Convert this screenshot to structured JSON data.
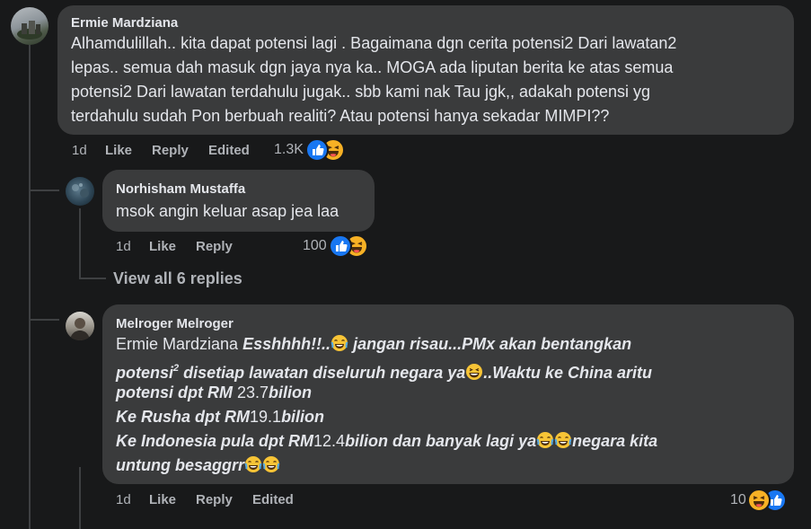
{
  "comments": [
    {
      "author": "Ermie Mardziana",
      "lines": [
        "Alhamdulillah.. kita dapat potensi lagi . Bagaimana dgn cerita potensi2 Dari lawatan2",
        "lepas.. semua dah masuk dgn jaya nya ka.. MOGA ada liputan berita ke atas semua",
        "potensi2 Dari lawatan terdahulu jugak.. sbb kami nak Tau jgk,, adakah potensi yg",
        "terdahulu sudah Pon berbuah realiti? Atau potensi hanya sekadar MIMPI??"
      ],
      "time": "1d",
      "like": "Like",
      "reply": "Reply",
      "edited": "Edited",
      "reaction_count": "1.3K"
    },
    {
      "author": "Norhisham Mustaffa",
      "text": "msok angin keluar asap jea laa",
      "time": "1d",
      "like": "Like",
      "reply": "Reply",
      "reaction_count": "100"
    },
    {
      "author": "Melroger Melroger",
      "mention": "Ermie Mardziana",
      "l1": [
        "Esshhhh!!..",
        "jangan risau...PMx akan bentangkan"
      ],
      "l2": [
        "potensi",
        "2",
        " disetiap lawatan diseluruh negara ya",
        "..Waktu ke China aritu"
      ],
      "l3": [
        "potensi dpt RM ",
        "23.7",
        "bilion"
      ],
      "l4": [
        "Ke Rusha dpt RM",
        "19.1",
        "bilion"
      ],
      "l5": [
        "Ke Indonesia pula dpt RM",
        "12.4",
        "bilion dan banyak lagi ya",
        "negara kita"
      ],
      "l6": [
        "untung besaggrr"
      ],
      "time": "1d",
      "like": "Like",
      "reply": "Reply",
      "edited": "Edited",
      "reaction_count": "10"
    }
  ],
  "view_replies": "View all 6 replies",
  "icons": {
    "like": "like-reaction-icon",
    "haha": "haha-reaction-icon",
    "laugh_emoji": "tears-of-joy-emoji",
    "grin_emoji": "grinning-squint-emoji"
  },
  "colors": {
    "background": "#18191a",
    "bubble": "#3a3b3c",
    "like_blue": "#1877f2",
    "haha_yellow": "#f7b125"
  }
}
